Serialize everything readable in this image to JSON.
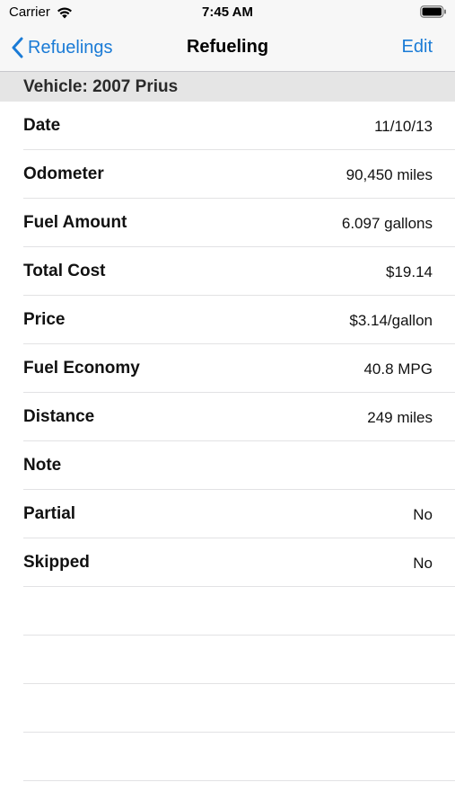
{
  "status_bar": {
    "carrier": "Carrier",
    "time": "7:45 AM"
  },
  "nav": {
    "back_label": "Refuelings",
    "title": "Refueling",
    "edit_label": "Edit"
  },
  "section": {
    "header": "Vehicle: 2007 Prius"
  },
  "rows": [
    {
      "label": "Date",
      "value": "11/10/13"
    },
    {
      "label": "Odometer",
      "value": "90,450 miles"
    },
    {
      "label": "Fuel Amount",
      "value": "6.097 gallons"
    },
    {
      "label": "Total Cost",
      "value": "$19.14"
    },
    {
      "label": "Price",
      "value": "$3.14/gallon"
    },
    {
      "label": "Fuel Economy",
      "value": "40.8 MPG"
    },
    {
      "label": "Distance",
      "value": "249 miles"
    },
    {
      "label": "Note",
      "value": ""
    },
    {
      "label": "Partial",
      "value": "No"
    },
    {
      "label": "Skipped",
      "value": "No"
    }
  ],
  "colors": {
    "accent": "#1a7bd6",
    "bar_background": "#f7f7f7",
    "section_background": "#e5e5e5"
  }
}
